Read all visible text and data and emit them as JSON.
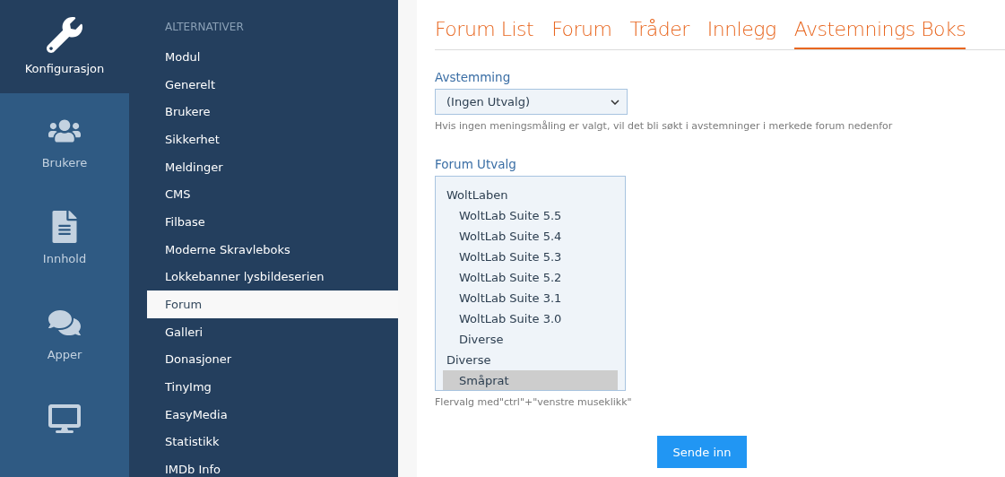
{
  "rail": [
    {
      "kind": "wrench",
      "label": "Konfigurasjon",
      "selected": true
    },
    {
      "kind": "users",
      "label": "Brukere",
      "selected": false
    },
    {
      "kind": "file",
      "label": "Innhold",
      "selected": false
    },
    {
      "kind": "chat",
      "label": "Apper",
      "selected": false
    },
    {
      "kind": "monitor",
      "selected": false
    }
  ],
  "submenu": {
    "heading": "ALTERNATIVER",
    "items": [
      {
        "label": "Modul",
        "selected": false
      },
      {
        "label": "Generelt",
        "selected": false
      },
      {
        "label": "Brukere",
        "selected": false
      },
      {
        "label": "Sikkerhet",
        "selected": false
      },
      {
        "label": "Meldinger",
        "selected": false
      },
      {
        "label": "CMS",
        "selected": false
      },
      {
        "label": "Filbase",
        "selected": false
      },
      {
        "label": "Moderne Skravleboks",
        "selected": false
      },
      {
        "label": "Lokkebanner lysbildeserien",
        "selected": false
      },
      {
        "label": "Forum",
        "selected": true
      },
      {
        "label": "Galleri",
        "selected": false
      },
      {
        "label": "Donasjoner",
        "selected": false
      },
      {
        "label": "TinyImg",
        "selected": false
      },
      {
        "label": "EasyMedia",
        "selected": false
      },
      {
        "label": "Statistikk",
        "selected": false
      },
      {
        "label": "IMDb Info",
        "selected": false
      }
    ]
  },
  "tabs": [
    {
      "label": "Forum List",
      "selected": false
    },
    {
      "label": "Forum",
      "selected": false
    },
    {
      "label": "Tråder",
      "selected": false
    },
    {
      "label": "Innlegg",
      "selected": false
    },
    {
      "label": "Avstemnings Boks",
      "selected": true
    }
  ],
  "poll": {
    "label": "Avstemming",
    "value": "(Ingen Utvalg)",
    "help": "Hvis ingen meningsmåling er valgt, vil det bli søkt i avstemninger i merkede forum nedenfor"
  },
  "forum_select": {
    "label": "Forum Utvalg",
    "options": [
      {
        "label": "WoltLaben",
        "selected": false,
        "children": [
          {
            "label": "WoltLab Suite 5.5",
            "selected": false
          },
          {
            "label": "WoltLab Suite 5.4",
            "selected": false
          },
          {
            "label": "WoltLab Suite 5.3",
            "selected": false
          },
          {
            "label": "WoltLab Suite 5.2",
            "selected": false
          },
          {
            "label": "WoltLab Suite 3.1",
            "selected": false
          },
          {
            "label": "WoltLab Suite 3.0",
            "selected": false
          },
          {
            "label": "Diverse",
            "selected": false
          }
        ]
      },
      {
        "label": "Diverse",
        "selected": false,
        "children": [
          {
            "label": "Småprat",
            "selected": true
          }
        ]
      }
    ],
    "help": "Flervalg med\"ctrl\"+\"venstre museklikk\""
  },
  "submit": "Sende inn"
}
